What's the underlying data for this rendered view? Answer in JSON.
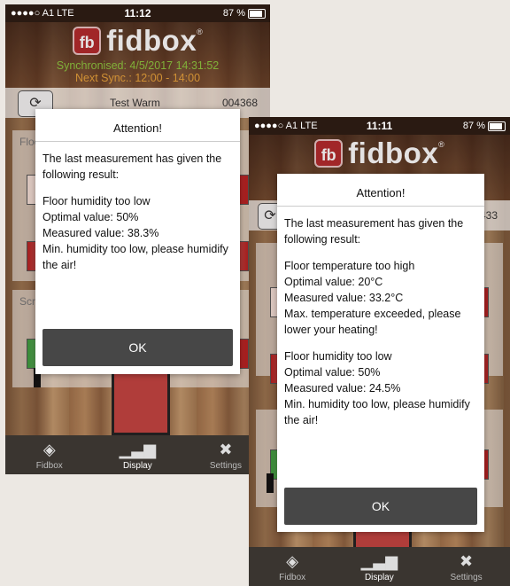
{
  "phone1": {
    "status": {
      "carrier": "●●●●○ A1  LTE",
      "time": "11:12",
      "battery": "87 %"
    },
    "logo": {
      "mark": "fb",
      "text": "fidbox",
      "reg": "®"
    },
    "sync": "Synchronised: 4/5/2017 14:31:52",
    "next_sync": "Next Sync.: 12:00 - 14:00",
    "device": {
      "name": "Test Warm",
      "id": "004368"
    },
    "panels": [
      {
        "title": "Floor"
      },
      {
        "title": "Screed"
      }
    ],
    "dialog": {
      "title": "Attention!",
      "intro": "The last measurement has given the following result:",
      "blocks": [
        [
          "Floor humidity too low",
          "Optimal value: 50%",
          "Measured value: 38.3%",
          "Min. humidity too low, please humidify the air!"
        ]
      ],
      "ok": "OK"
    },
    "tabs": [
      {
        "icon": "layers-icon",
        "label": "Fidbox"
      },
      {
        "icon": "chart-icon",
        "label": "Display"
      },
      {
        "icon": "tools-icon",
        "label": "Settings"
      }
    ]
  },
  "phone2": {
    "status": {
      "carrier": "●●●●○ A1  LTE",
      "time": "11:11",
      "battery": "87 %"
    },
    "logo": {
      "mark": "fb",
      "text": "fidbox",
      "reg": "®"
    },
    "device": {
      "id": "000433"
    },
    "dialog": {
      "title": "Attention!",
      "intro": "The last measurement has given the following result:",
      "blocks": [
        [
          "Floor temperature too high",
          "Optimal value: 20°C",
          "Measured value: 33.2°C",
          "Max. temperature exceeded, please lower your heating!"
        ],
        [
          "Floor humidity too low",
          "Optimal value: 50%",
          "Measured value: 24.5%",
          "Min. humidity too low, please humidify the air!"
        ]
      ],
      "ok": "OK"
    },
    "tabs": [
      {
        "icon": "layers-icon",
        "label": "Fidbox"
      },
      {
        "icon": "chart-icon",
        "label": "Display"
      },
      {
        "icon": "tools-icon",
        "label": "Settings"
      }
    ]
  },
  "colors": {
    "sync_green": "#8ec63f",
    "next_sync_orange": "#e8a23a",
    "brand_red": "#b32a2c",
    "ok_button": "#474747"
  }
}
